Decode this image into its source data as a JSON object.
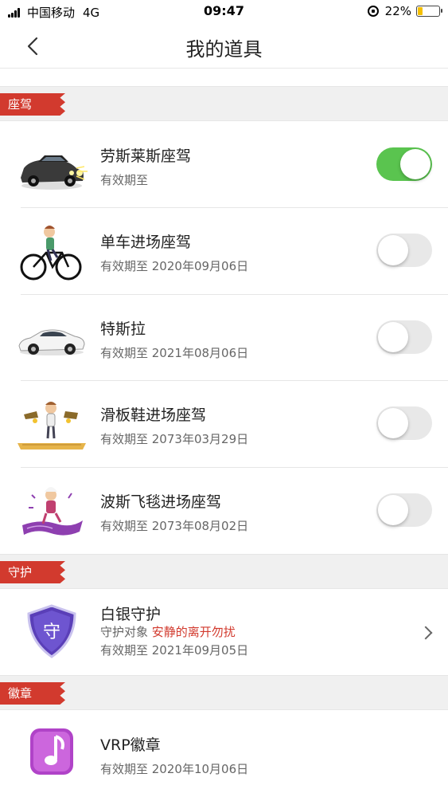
{
  "status_bar": {
    "carrier": "中国移动",
    "network": "4G",
    "time": "09:47",
    "battery_percent": "22%",
    "battery_level": 0.22
  },
  "header": {
    "title": "我的道具",
    "back_icon": "chevron-left-icon"
  },
  "sections": [
    {
      "label": "座驾",
      "items": [
        {
          "name": "劳斯莱斯座驾",
          "validity": "有效期至",
          "enabled": true,
          "thumb": "rolls-royce-car"
        },
        {
          "name": "单车进场座驾",
          "validity": "有效期至 2020年09月06日",
          "enabled": false,
          "thumb": "bicycle-rider"
        },
        {
          "name": "特斯拉",
          "validity": "有效期至 2021年08月06日",
          "enabled": false,
          "thumb": "tesla-car"
        },
        {
          "name": "滑板鞋进场座驾",
          "validity": "有效期至 2073年03月29日",
          "enabled": false,
          "thumb": "skate-shoes"
        },
        {
          "name": "波斯飞毯进场座驾",
          "validity": "有效期至 2073年08月02日",
          "enabled": false,
          "thumb": "flying-carpet"
        }
      ]
    },
    {
      "label": "守护",
      "items": [
        {
          "name": "白银守护",
          "target_label": "守护对象",
          "target_name": "安静的离开勿扰",
          "validity": "有效期至 2021年09月05日",
          "thumb": "shield-badge",
          "badge_text": "守"
        }
      ]
    },
    {
      "label": "徽章",
      "items": [
        {
          "name": "VRP徽章",
          "validity": "有效期至 2020年10月06日",
          "thumb": "music-badge"
        }
      ]
    }
  ],
  "colors": {
    "accent_red": "#d23a2e",
    "toggle_on": "#5ac44f",
    "toggle_off": "#e8e8e8"
  }
}
